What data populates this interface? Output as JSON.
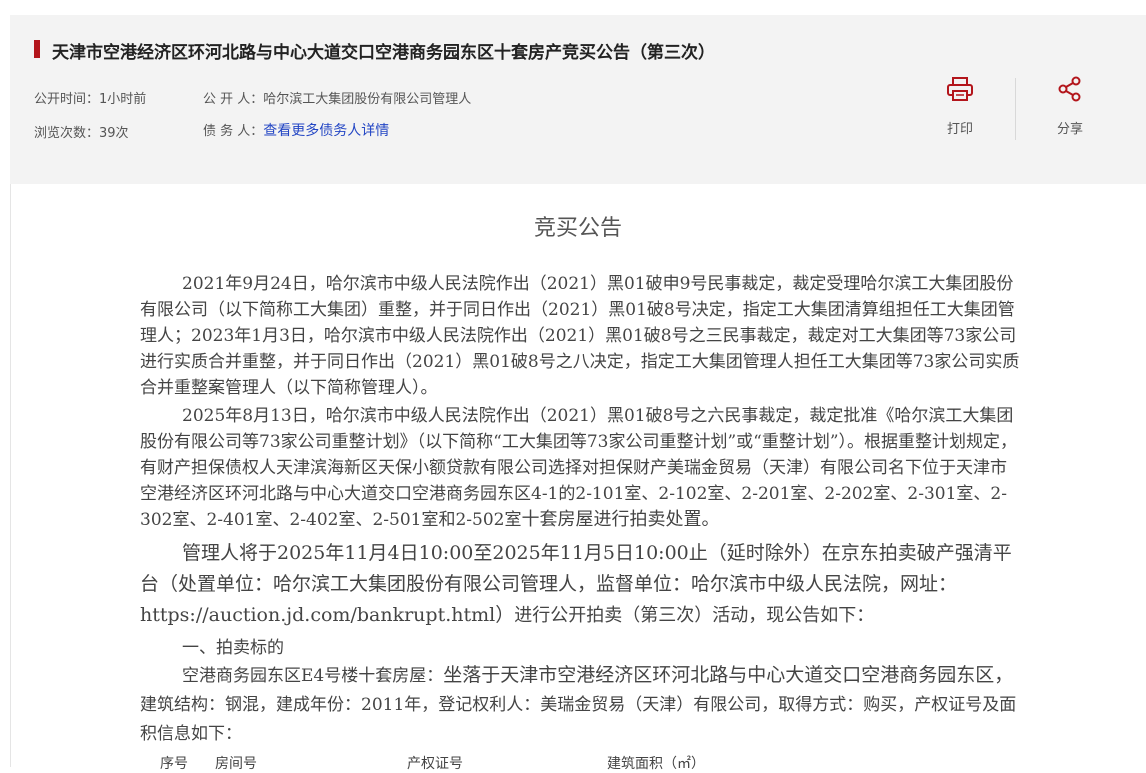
{
  "header": {
    "title": "天津市空港经济区环河北路与中心大道交口空港商务园东区十套房产竞买公告（第三次）",
    "publish_time_label": "公开时间：",
    "publish_time_value": "1小时前",
    "publisher_label": "公 开 人：",
    "publisher_value": "哈尔滨工大集团股份有限公司管理人",
    "views_label": "浏览次数：",
    "views_value": "39次",
    "debtor_label": "债 务 人：",
    "debtor_link": "查看更多债务人详情",
    "print_label": "打印",
    "share_label": "分享",
    "accent_color": "#b3151b"
  },
  "document": {
    "heading": "竞买公告",
    "paragraph1": "2021年9月24日，哈尔滨市中级人民法院作出（2021）黑01破申9号民事裁定，裁定受理哈尔滨工大集团股份有限公司（以下简称工大集团）重整，并于同日作出（2021）黑01破8号决定，指定工大集团清算组担任工大集团管理人；2023年1月3日，哈尔滨市中级人民法院作出（2021）黑01破8号之三民事裁定，裁定对工大集团等73家公司进行实质合并重整，并于同日作出（2021）黑01破8号之八决定，指定工大集团管理人担任工大集团等73家公司实质合并重整案管理人（以下简称管理人）。",
    "paragraph2": "2025年8月13日，哈尔滨市中级人民法院作出（2021）黑01破8号之六民事裁定，裁定批准《哈尔滨工大集团股份有限公司等73家公司重整计划》（以下简称“工大集团等73家公司重整计划”或“重整计划”）。根据重整计划规定，有财产担保债权人天津滨海新区天保小额贷款有限公司选择对担保财产美瑞金贸易（天津）有限公司名下位于天津市空港经济区环河北路与中心大道交口空港商务园东区4-1的2-101室、2-102室、2-201室、2-202室、2-301室、2-302室、2-401室、2-402室、2-501室和2-502室",
    "paragraph2_tail": "十套房屋进行拍卖处置。",
    "paragraph3": "管理人将于2025年11月4日10:00至2025年11月5日10:00止（延时除外）在京东拍卖破产强清平台（处置单位：哈尔滨工大集团股份有限公司管理人，监督单位：哈尔滨市中级人民法院，网址：https://auction.jd.com/bankrupt.html）",
    "paragraph3_tail": "进行公开拍卖（第三次）活动，现公告如下：",
    "section1": "一、拍卖标的",
    "paragraph4_head": "空港商务园东区E4号楼十套房屋：",
    "paragraph4_big": "坐落于天津市空港经济区环河北路与中心大道交口空港商务园东区，",
    "paragraph4": "建筑结构：钢混，建成年份：2011年，登记权利人：美瑞金贸易（天津）有限公司，取得方式：购买，产权证号及面积信息如下：",
    "table_headers": [
      "序号",
      "房间号",
      "产权证号",
      "建筑面积（㎡）"
    ]
  }
}
